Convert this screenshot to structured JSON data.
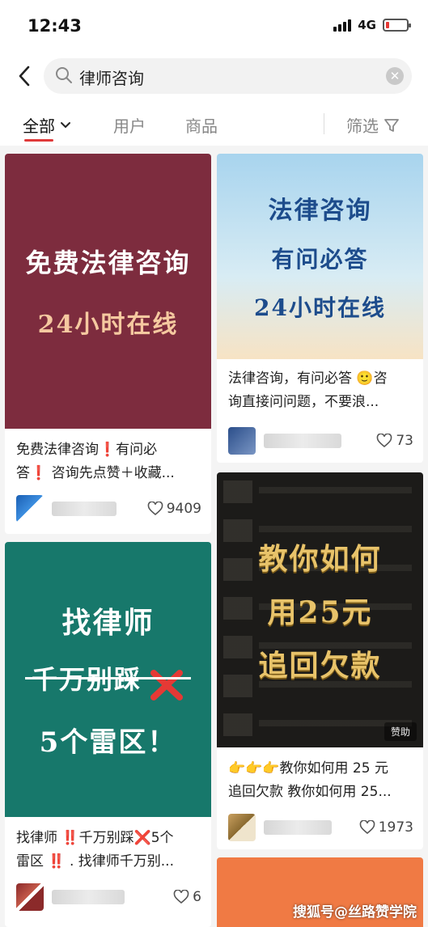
{
  "status_bar": {
    "time": "12:43",
    "network": "4G"
  },
  "search": {
    "query": "律师咨询"
  },
  "tabs": [
    {
      "label": "全部",
      "active": true
    },
    {
      "label": "用户",
      "active": false
    },
    {
      "label": "商品",
      "active": false
    }
  ],
  "filter_label": "筛选",
  "colors": {
    "accent": "#e03a3a",
    "card1": "#7d2c3e",
    "card3": "#17786b",
    "card4": "#1c1b19",
    "card5": "#f07a44"
  },
  "posts": [
    {
      "cover_lines": [
        "免费法律咨询",
        "24小时在线"
      ],
      "caption_lines": [
        "免费法律咨询❗有问必",
        "答❗ 咨询先点赞＋收藏..."
      ],
      "likes": "9409"
    },
    {
      "cover_lines": [
        "法律咨询",
        "有问必答",
        "24小时在线"
      ],
      "caption_lines": [
        "法律咨询，有问必答 🙂咨",
        "询直接问问题，不要浪..."
      ],
      "likes": "73"
    },
    {
      "cover_lines": [
        "找律师",
        "千万别踩",
        "5个雷区！"
      ],
      "caption_lines": [
        "找律师 ‼️千万别踩❌5个",
        "雷区 ‼️ . 找律师千万别..."
      ],
      "likes": "6"
    },
    {
      "cover_lines": [
        "教你如何",
        "用25元",
        "追回欠款"
      ],
      "caption_lines": [
        "👉👉👉教你如何用 25 元",
        "追回欠款 教你如何用 25..."
      ],
      "ad_label": "赞助",
      "likes": "1973"
    }
  ],
  "watermark": "搜狐号@丝路赞学院"
}
